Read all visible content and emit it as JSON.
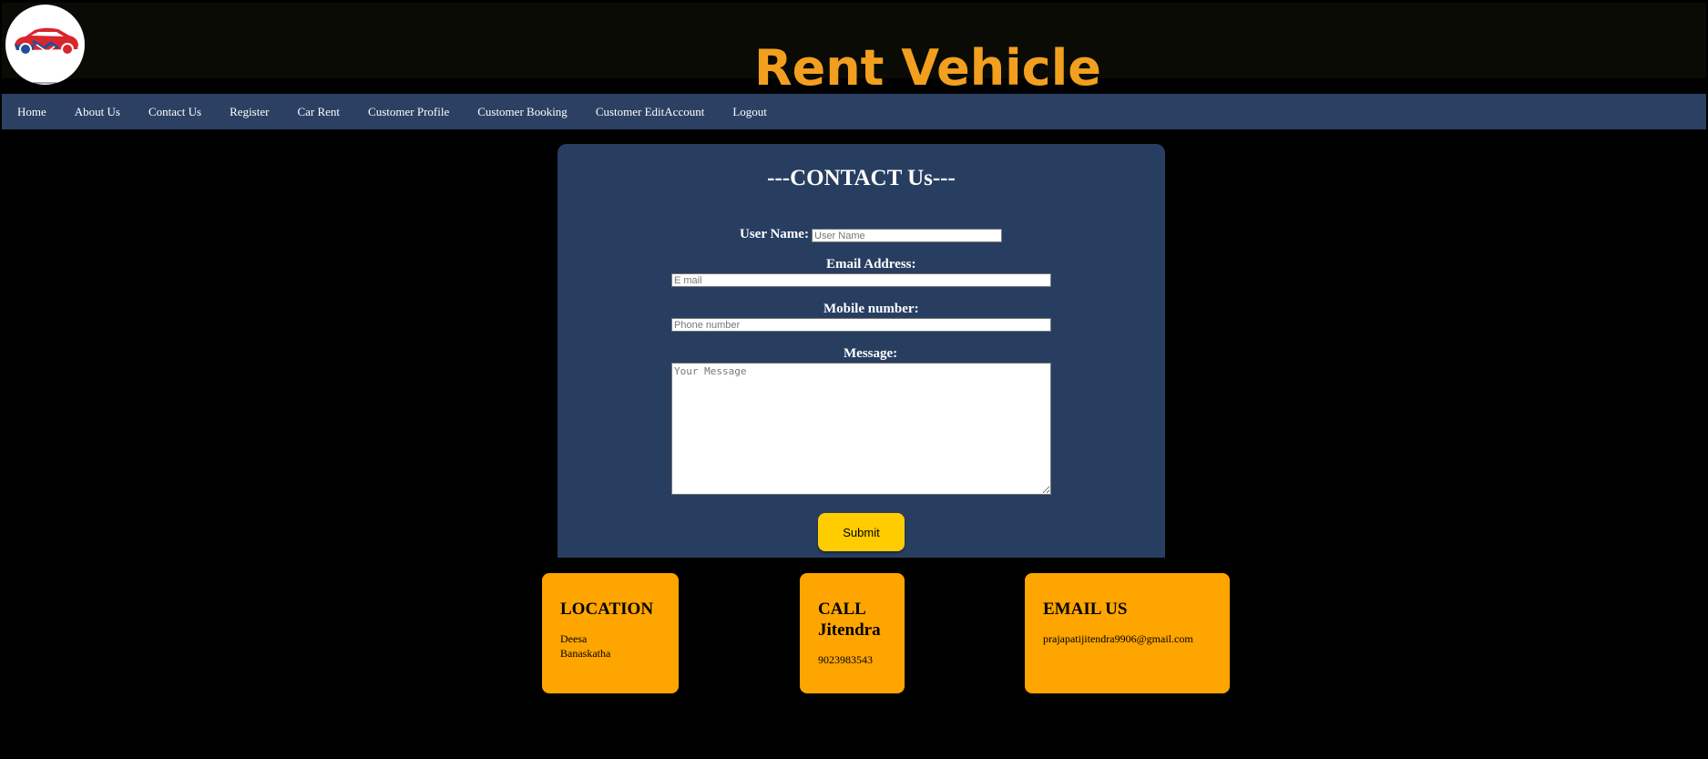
{
  "header": {
    "title": "Rent Vehicle",
    "logo_icon": "handshake-car-logo-icon",
    "colors": {
      "title": "#f29f1f",
      "header_bg": "#0b0b05"
    }
  },
  "nav": {
    "bg_color": "#2b4063",
    "items": [
      {
        "label": "Home"
      },
      {
        "label": "About Us"
      },
      {
        "label": "Contact Us"
      },
      {
        "label": "Register"
      },
      {
        "label": "Car Rent"
      },
      {
        "label": "Customer Profile"
      },
      {
        "label": "Customer Booking"
      },
      {
        "label": "Customer EditAccount"
      },
      {
        "label": "Logout"
      }
    ]
  },
  "contact_form": {
    "title": "---CONTACT Us---",
    "bg_color": "#283e61",
    "username": {
      "label": "User Name:",
      "placeholder": "User Name",
      "value": ""
    },
    "email": {
      "label": "Email Address:",
      "placeholder": "E mail",
      "value": ""
    },
    "mobile": {
      "label": "Mobile number:",
      "placeholder": "Phone number",
      "value": ""
    },
    "message": {
      "label": "Message:",
      "placeholder": "Your Message",
      "value": ""
    },
    "submit_label": "Submit",
    "submit_color": "#ffcc00"
  },
  "cards": {
    "color": "#ffa500",
    "location": {
      "title": "LOCATION",
      "line1": "Deesa",
      "line2": "Banaskatha"
    },
    "call": {
      "title_line1": "CALL",
      "title_line2": "Jitendra",
      "phone": "9023983543"
    },
    "email": {
      "title": "EMAIL US",
      "address": "prajapatijitendra9906@gmail.com"
    }
  }
}
